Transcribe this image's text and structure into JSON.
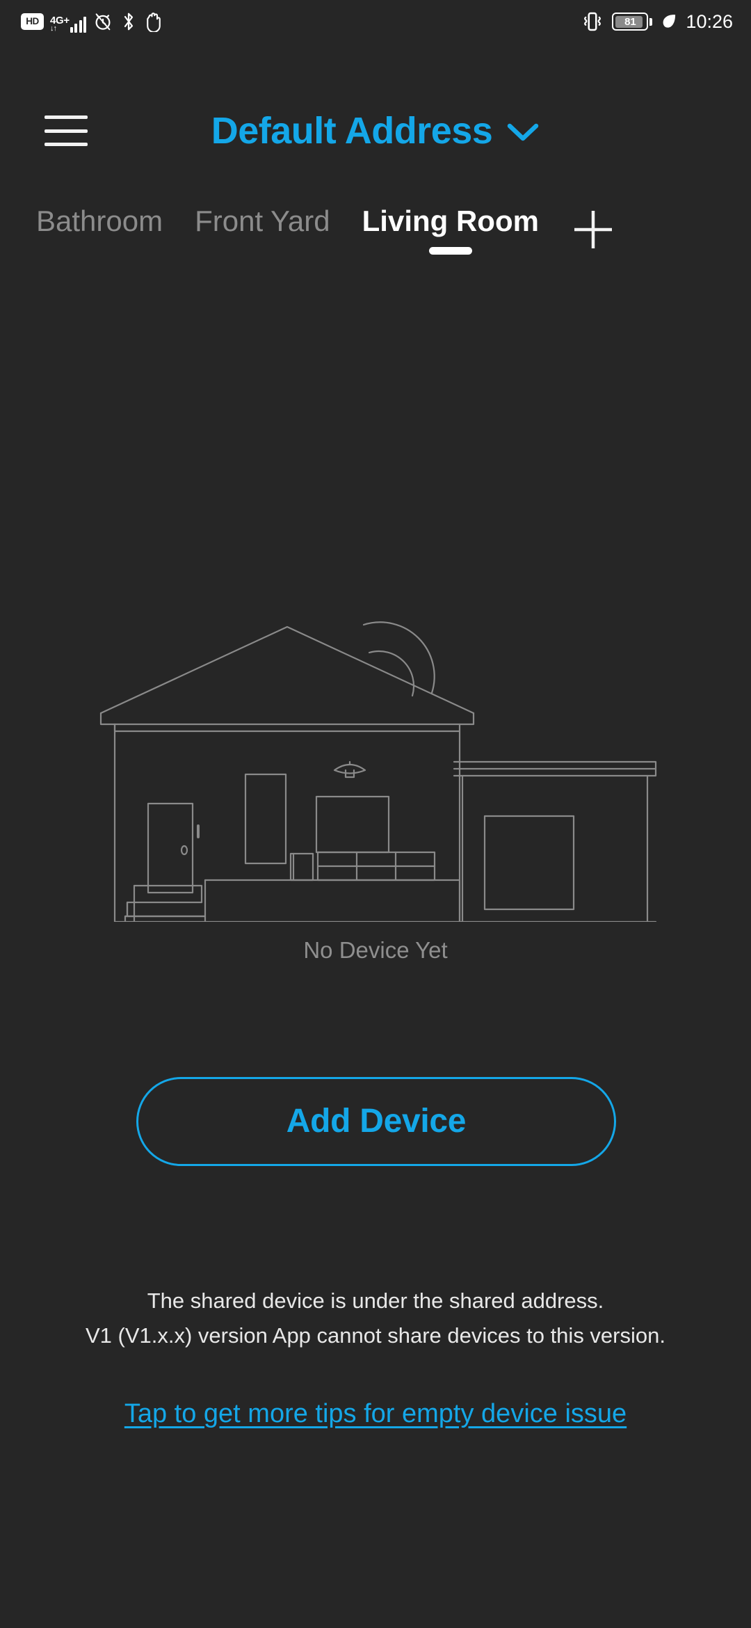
{
  "status_bar": {
    "hd_label": "HD",
    "network_label": "4G",
    "network_plus": "+",
    "signal_bars": 4,
    "icons": [
      "hd-badge-icon",
      "network-4g-icon",
      "signal-bars-icon",
      "alarm-muted-icon",
      "bluetooth-icon",
      "hand-gesture-icon",
      "vibrate-icon",
      "battery-icon",
      "eco-leaf-icon"
    ],
    "battery_percent": "81",
    "time": "10:26"
  },
  "header": {
    "menu_icon": "hamburger-menu-icon",
    "address_title": "Default Address",
    "chevron_icon": "chevron-down-icon"
  },
  "room_tabs": {
    "tabs": [
      {
        "label": "Bathroom",
        "active": false
      },
      {
        "label": "Front Yard",
        "active": false
      },
      {
        "label": "Living Room",
        "active": true
      }
    ],
    "add_icon": "plus-icon"
  },
  "empty_state": {
    "illustration": "house-line-art-illustration",
    "message": "No Device Yet"
  },
  "add_device": {
    "label": "Add Device"
  },
  "footer": {
    "line1": "The shared device is under the shared address.",
    "line2": "V1 (V1.x.x) version App cannot share devices to this version.",
    "tips_link": "Tap to get more tips for empty device issue"
  },
  "colors": {
    "background": "#262626",
    "accent": "#14A7E8",
    "active_tab": "#ffffff",
    "inactive_tab": "#8c8c8c",
    "muted_text": "#8f8f8f",
    "illustration_stroke": "#8a8a8a"
  }
}
